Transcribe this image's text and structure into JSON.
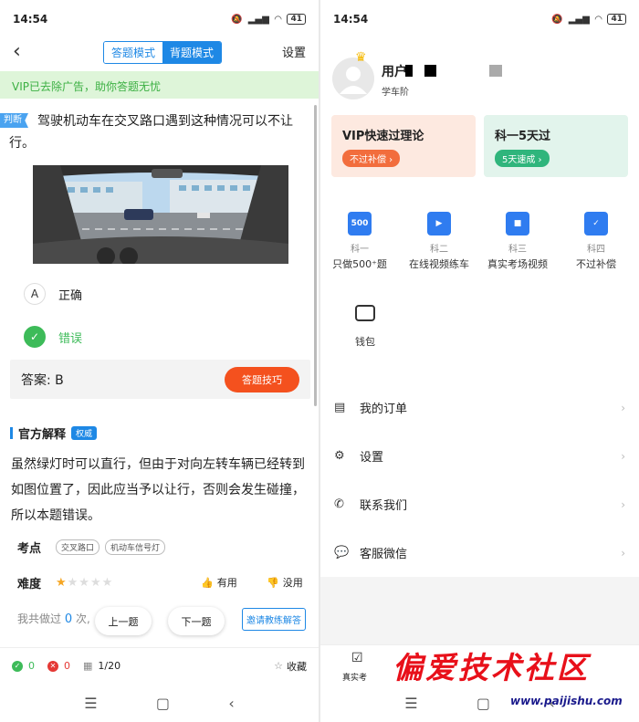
{
  "left": {
    "status_time": "14:54",
    "status_battery": "41",
    "nav": {
      "tab_answer": "答题模式",
      "tab_memorize": "背题模式",
      "settings": "设置"
    },
    "vip_notice": "VIP已去除广告，助你答题无忧",
    "question_tag": "判断",
    "question_text": "驾驶机动车在交叉路口遇到这种情况可以不让行。",
    "options": [
      {
        "key": "A",
        "text": "正确"
      },
      {
        "key": "✓",
        "text": "错误"
      }
    ],
    "answer_label": "答案: B",
    "tips_button": "答题技巧",
    "explain_title": "官方解释",
    "explain_badge": "权威",
    "explain_text": "虽然绿灯时可以直行，但由于对向左转车辆已经转到如图位置了，因此应当予以让行，否则会发生碰撞，所以本题错误。",
    "kaodian_label": "考点",
    "kaodian_tags": [
      "交叉路口",
      "机动车信号灯"
    ],
    "difficulty_label": "难度",
    "difficulty_stars": 1,
    "useful": "有用",
    "useless": "没用",
    "done_prefix": "我共做过",
    "done_count": "0",
    "done_suffix": "次,",
    "prev": "上一题",
    "next": "下一题",
    "invite": "邀请教练解答",
    "correct_count": "0",
    "wrong_count": "0",
    "progress": "1/20",
    "collect": "收藏"
  },
  "right": {
    "status_time": "14:54",
    "status_battery": "41",
    "user_name": "用户",
    "user_sub": "学车阶",
    "cards": [
      {
        "title": "VIP快速过理论",
        "button": "不过补偿 ›"
      },
      {
        "title": "科一5天过",
        "button": "5天速成 ›"
      }
    ],
    "grid": [
      {
        "icon": "500",
        "cap": "科一",
        "name": "只做500⁺题"
      },
      {
        "icon": "▶",
        "cap": "科二",
        "name": "在线视频练车"
      },
      {
        "icon": "■",
        "cap": "科三",
        "name": "真实考场视频"
      },
      {
        "icon": "✓",
        "cap": "科四",
        "name": "不过补偿"
      },
      {
        "icon": "",
        "cap": "",
        "name": "钱包"
      }
    ],
    "menu": [
      "我的订单",
      "设置",
      "联系我们",
      "客服微信"
    ],
    "tab_label": "真实考",
    "watermark": "偏爱技术社区",
    "watermark_url": "www.paijishu.com"
  },
  "colors": {
    "primary": "#1e88e5",
    "success": "#3dbb59",
    "warn": "#f4511e"
  }
}
